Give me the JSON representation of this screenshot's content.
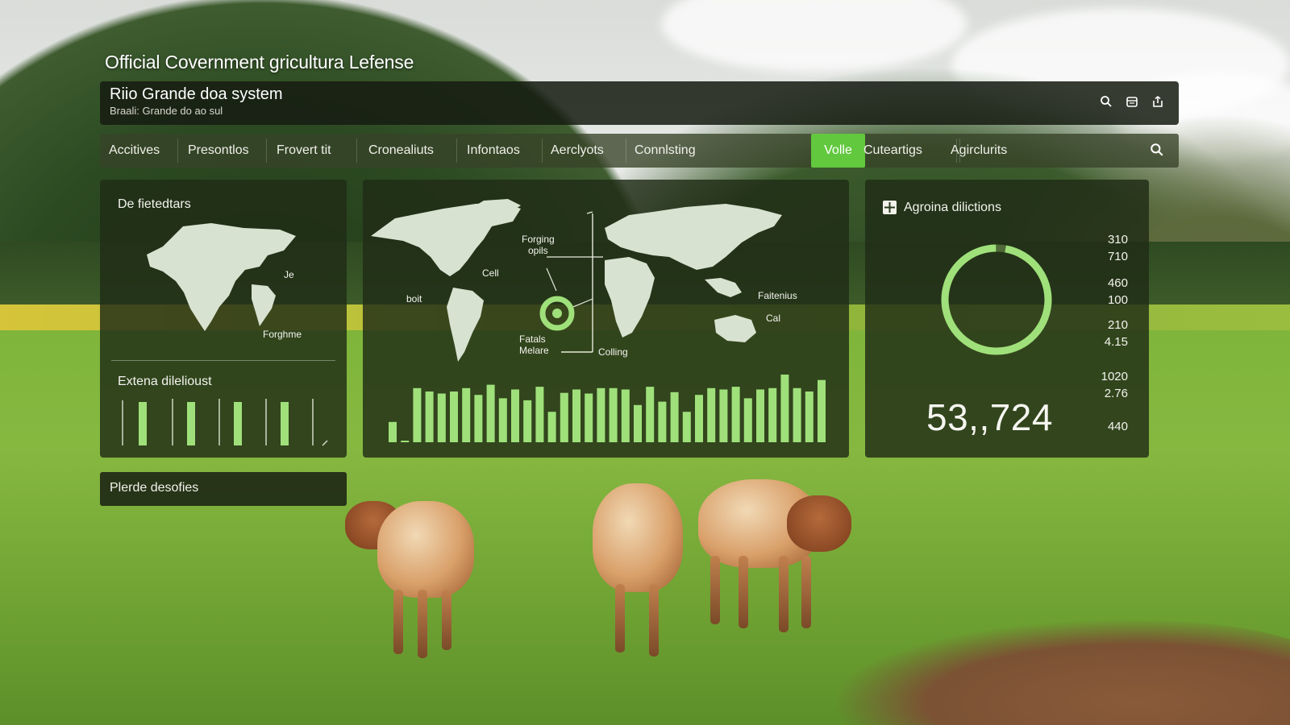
{
  "window_title": "Official Covernment gricultura Lefense",
  "header": {
    "title": "Riio Grande doa system",
    "subtitle": "Braali: Grande do ao sul",
    "icons": [
      "search-icon",
      "calendar-icon",
      "share-icon"
    ]
  },
  "nav": {
    "items": [
      {
        "label": "Accitives"
      },
      {
        "label": "Presontlos"
      },
      {
        "label": "Frovert tit"
      },
      {
        "label": "Cronealiuts"
      },
      {
        "label": "Infontaos"
      },
      {
        "label": "Aerclyots"
      },
      {
        "label": "Connlsting"
      },
      {
        "label": "Volle",
        "active": true
      },
      {
        "label": "Cuteartigs"
      },
      {
        "label": "Agirclurits"
      }
    ],
    "search_icon": "search-icon"
  },
  "left_panel": {
    "map_title": "De fietedtars",
    "map_labels": [
      "Je",
      "Forghme"
    ],
    "bars_title": "Extena dilelioust"
  },
  "center_panel": {
    "map_labels": {
      "forging": "Forging\nopils",
      "cell_left": "Cell",
      "boit": "boit",
      "fatals": "Fatals\nMelare",
      "colling": "Colling",
      "faitenius": "Faitenius",
      "cal": "Cal"
    },
    "bar_values": [
      0.3,
      0.02,
      0.8,
      0.75,
      0.72,
      0.75,
      0.8,
      0.7,
      0.85,
      0.65,
      0.78,
      0.62,
      0.82,
      0.45,
      0.73,
      0.78,
      0.72,
      0.8,
      0.8,
      0.78,
      0.55,
      0.82,
      0.6,
      0.74,
      0.45,
      0.7,
      0.8,
      0.78,
      0.82,
      0.65,
      0.78,
      0.8,
      1.0,
      0.8,
      0.75,
      0.92
    ]
  },
  "right_panel": {
    "title": "Agroina dilictions",
    "legend_values": [
      "310",
      "710",
      "460",
      "100",
      "210",
      "4.15",
      "1020",
      "2.76",
      "440"
    ],
    "donut_fill": 0.97,
    "big_number": "53,,724"
  },
  "footer_panel": {
    "label": "Plerde desofies"
  },
  "colors": {
    "accent_green": "#62c83e",
    "bar_green": "#9fe07a",
    "panel_bg": "#202c16"
  }
}
